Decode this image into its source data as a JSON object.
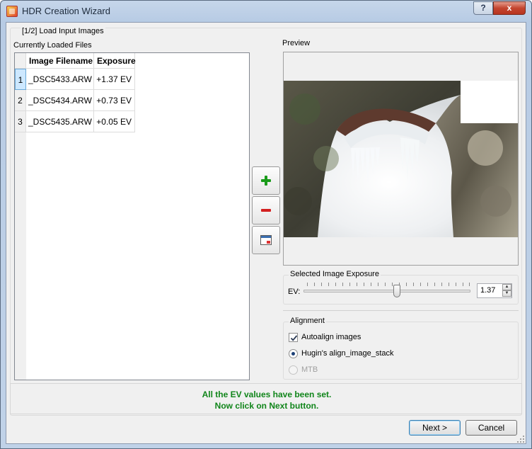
{
  "window": {
    "title": "HDR Creation Wizard",
    "help_label": "?",
    "close_label": "x"
  },
  "step": {
    "title": "[1/2] Load Input Images"
  },
  "files": {
    "label": "Currently Loaded Files",
    "columns": [
      "Image Filename",
      "Exposure"
    ],
    "rows": [
      {
        "index": "1",
        "filename": "_DSC5433.ARW",
        "exposure": "+1.37 EV"
      },
      {
        "index": "2",
        "filename": "_DSC5434.ARW",
        "exposure": "+0.73 EV"
      },
      {
        "index": "3",
        "filename": "_DSC5435.ARW",
        "exposure": "+0.05 EV"
      }
    ],
    "selected_row": 0
  },
  "side_buttons": [
    {
      "icon": "plus-icon",
      "color": "#1a9b1a"
    },
    {
      "icon": "minus-icon",
      "color": "#d32020"
    },
    {
      "icon": "image-window-icon",
      "color": "#3b6fb0"
    }
  ],
  "preview": {
    "label": "Preview"
  },
  "exposure": {
    "group_title": "Selected Image Exposure",
    "ev_label": "EV:",
    "value": "1.37",
    "slider_fraction": 0.56
  },
  "alignment": {
    "group_title": "Alignment",
    "autoalign_label": "Autoalign images",
    "autoalign_checked": true,
    "method_hugin_label": "Hugin's align_image_stack",
    "method_mtb_label": "MTB",
    "selected_method": "hugin"
  },
  "status": {
    "line1": "All the EV values have been set.",
    "line2": "Now click on Next button.",
    "color": "#10851a"
  },
  "buttons": {
    "next_label": "Next >",
    "cancel_label": "Cancel"
  }
}
